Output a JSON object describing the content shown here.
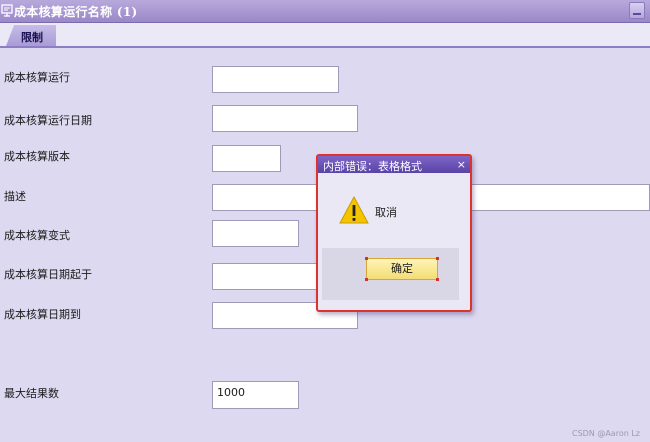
{
  "window": {
    "title": "成本核算运行名称 (1)"
  },
  "tabs": [
    {
      "label": "限制",
      "active": true
    }
  ],
  "form": {
    "fields": [
      {
        "label": "成本核算运行",
        "value": ""
      },
      {
        "label": "成本核算运行日期",
        "value": ""
      },
      {
        "label": "成本核算版本",
        "value": ""
      },
      {
        "label": "描述",
        "value": ""
      },
      {
        "label": "成本核算变式",
        "value": ""
      },
      {
        "label": "成本核算日期起于",
        "value": ""
      },
      {
        "label": "成本核算日期到",
        "value": ""
      },
      {
        "label": "最大结果数",
        "value": "1000"
      }
    ]
  },
  "dialog": {
    "title": "内部错误：表格格式",
    "close_glyph": "×",
    "message": "取消",
    "ok_label": "确定",
    "icon": "warning-icon"
  },
  "watermark": "CSDN @Aaron Lz",
  "colors": {
    "titlebar": "#9b88c8",
    "background": "#dcd9f0",
    "dialog_title": "#5a43a6",
    "highlight": "#e0322c",
    "ok_button": "#f4dc74"
  }
}
